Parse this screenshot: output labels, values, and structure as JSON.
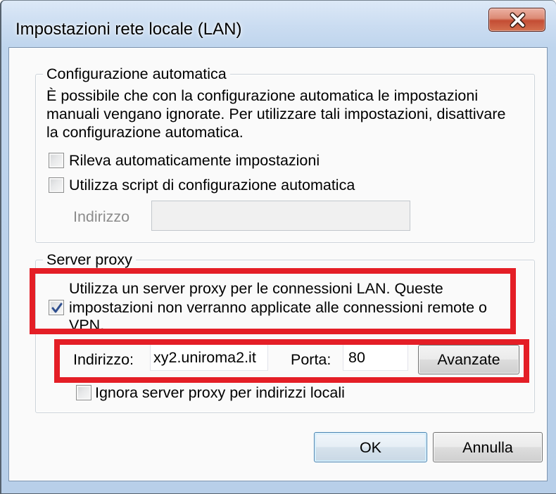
{
  "window": {
    "title": "Impostazioni rete locale (LAN)"
  },
  "auto_config": {
    "legend": "Configurazione automatica",
    "description_lines": [
      "È possibile che con la configurazione automatica le impostazioni",
      "manuali vengano ignorate. Per utilizzare tali impostazioni, disattivare",
      "la configurazione automatica."
    ],
    "detect_settings": {
      "label": "Rileva automaticamente impostazioni",
      "checked": false
    },
    "use_script": {
      "label": "Utilizza script di configurazione automatica",
      "checked": false
    },
    "address_label": "Indirizzo"
  },
  "proxy": {
    "legend": "Server proxy",
    "use_proxy": {
      "label_lines": [
        "Utilizza un server proxy per le connessioni LAN. Queste",
        "impostazioni non verranno applicate alle connessioni remote o",
        "VPN."
      ],
      "checked": true
    },
    "address_label": "Indirizzo:",
    "address_value": "xy2.uniroma2.it",
    "port_label": "Porta:",
    "port_value": "80",
    "advanced_button": "Avanzate",
    "bypass_local": {
      "label": "Ignora server proxy per indirizzi locali",
      "checked": false
    }
  },
  "footer": {
    "ok_button": "OK",
    "cancel_button": "Annulla"
  },
  "icons": {
    "close": "close-icon",
    "check": "check-icon"
  },
  "colors": {
    "highlight_annotation": "#e41e26",
    "close_button": "#c44d34",
    "title_bar": "#cadcf1",
    "default_button_border": "#3c7fb1"
  }
}
